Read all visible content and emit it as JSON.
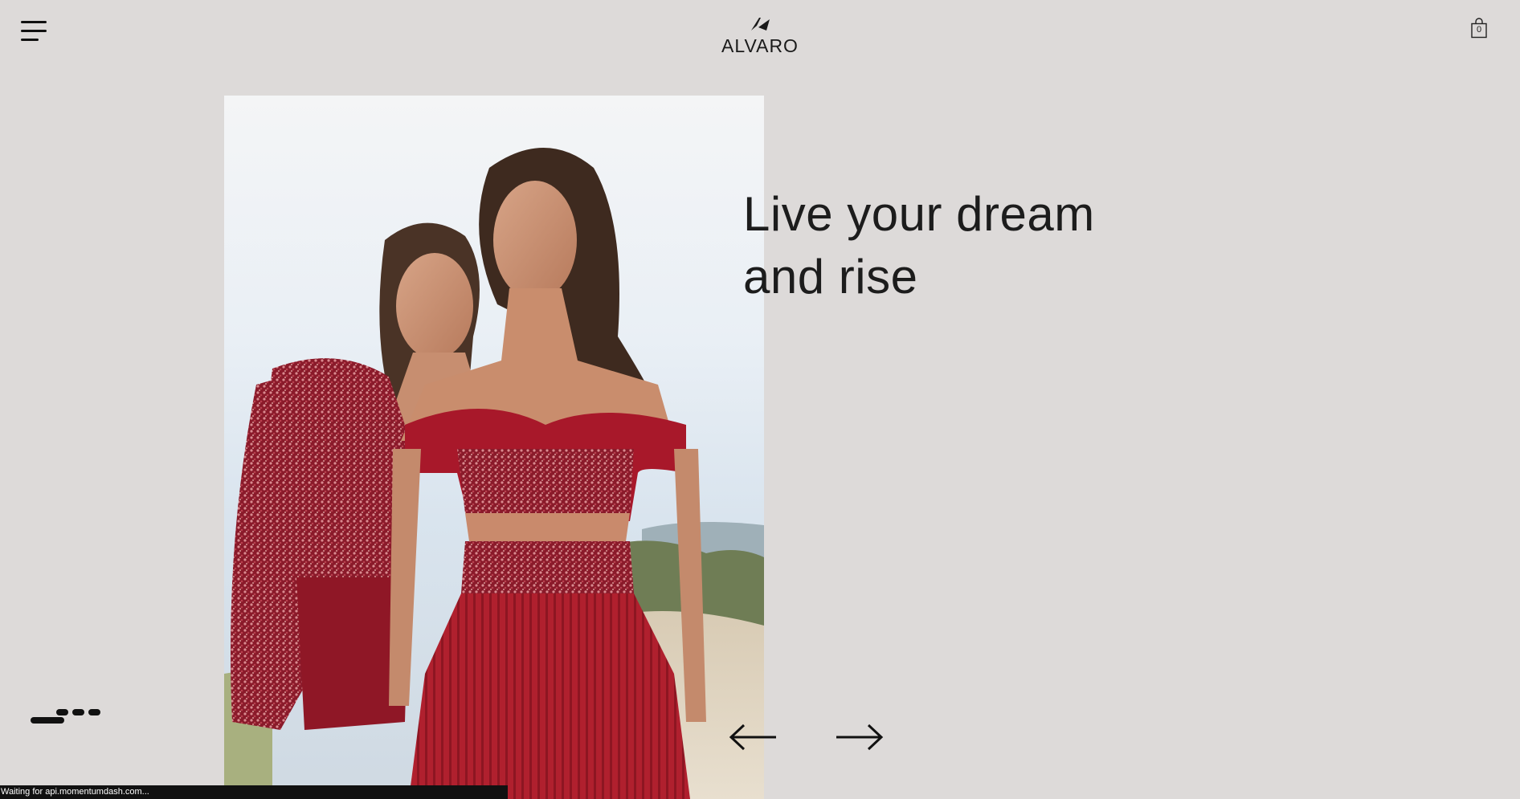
{
  "header": {
    "menu_icon": "hamburger-menu-icon",
    "brand_name": "ALVARO",
    "logo_icon": "alvaro-logo-mark-icon",
    "cart_icon": "shopping-bag-icon",
    "cart_count": "0"
  },
  "hero": {
    "headline_line1": "Live your dream",
    "headline_line2": "and rise",
    "image_subject": "two models in red sequined dresses",
    "prev_icon": "arrow-left-icon",
    "next_icon": "arrow-right-icon"
  },
  "slider": {
    "total_slides": 4,
    "active_slide": 1
  },
  "status_bar": {
    "text": "Waiting for api.momentumdash.com..."
  },
  "colors": {
    "background": "#dddad9",
    "text": "#1a1a1a",
    "dress_red": "#a11b2a",
    "sky": "#eef2f6",
    "status_bg": "#111111"
  }
}
